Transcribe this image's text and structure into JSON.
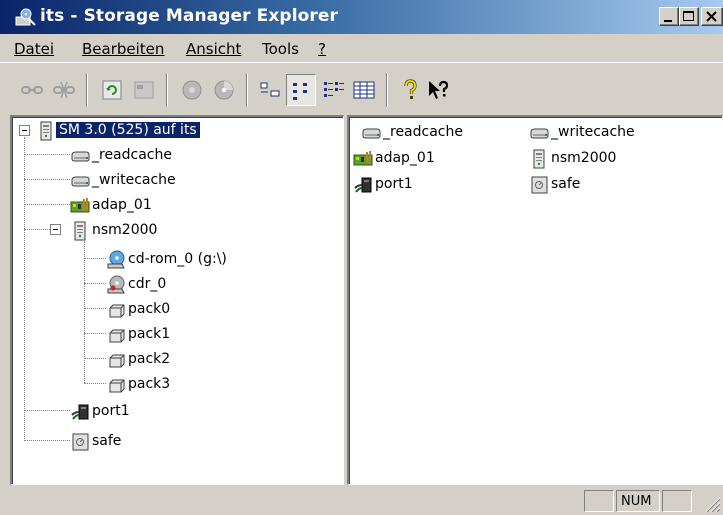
{
  "window": {
    "title": "its - Storage Manager Explorer"
  },
  "menu": [
    {
      "label": "Datei",
      "name": "menu-datei"
    },
    {
      "label": "Bearbeiten",
      "name": "menu-bearbeiten"
    },
    {
      "label": "Ansicht",
      "name": "menu-ansicht"
    },
    {
      "label": "Tools",
      "name": "menu-tools"
    },
    {
      "label": "?",
      "name": "menu-help"
    }
  ],
  "toolbar": {
    "icons": [
      "connect-icon",
      "disconnect-icon",
      "refresh-icon",
      "properties-icon",
      "disk-icon",
      "cd-icon",
      "large-icons-view-icon",
      "small-icons-view-icon",
      "list-view-icon",
      "details-view-icon",
      "help-icon",
      "whats-this-icon"
    ]
  },
  "tree": {
    "root": "SM 3.0 (525) auf its",
    "items": [
      {
        "label": "_readcache",
        "icon": "cache-drive-icon"
      },
      {
        "label": "_writecache",
        "icon": "cache-drive-icon"
      },
      {
        "label": "adap_01",
        "icon": "adapter-icon"
      },
      {
        "label": "nsm2000",
        "icon": "server-icon"
      },
      {
        "label": "cd-rom_0 (g:\\)",
        "icon": "cdrom-icon"
      },
      {
        "label": "cdr_0",
        "icon": "cd-writer-icon"
      },
      {
        "label": "pack0",
        "icon": "pack-icon"
      },
      {
        "label": "pack1",
        "icon": "pack-icon"
      },
      {
        "label": "pack2",
        "icon": "pack-icon"
      },
      {
        "label": "pack3",
        "icon": "pack-icon"
      },
      {
        "label": "port1",
        "icon": "port-icon"
      },
      {
        "label": "safe",
        "icon": "safe-icon"
      }
    ]
  },
  "list": {
    "items": [
      {
        "label": "_readcache",
        "icon": "cache-drive-icon"
      },
      {
        "label": "_writecache",
        "icon": "cache-drive-icon"
      },
      {
        "label": "adap_01",
        "icon": "adapter-icon"
      },
      {
        "label": "nsm2000",
        "icon": "server-icon"
      },
      {
        "label": "port1",
        "icon": "port-icon"
      },
      {
        "label": "safe",
        "icon": "safe-icon"
      }
    ]
  },
  "status": {
    "num": "NUM"
  }
}
